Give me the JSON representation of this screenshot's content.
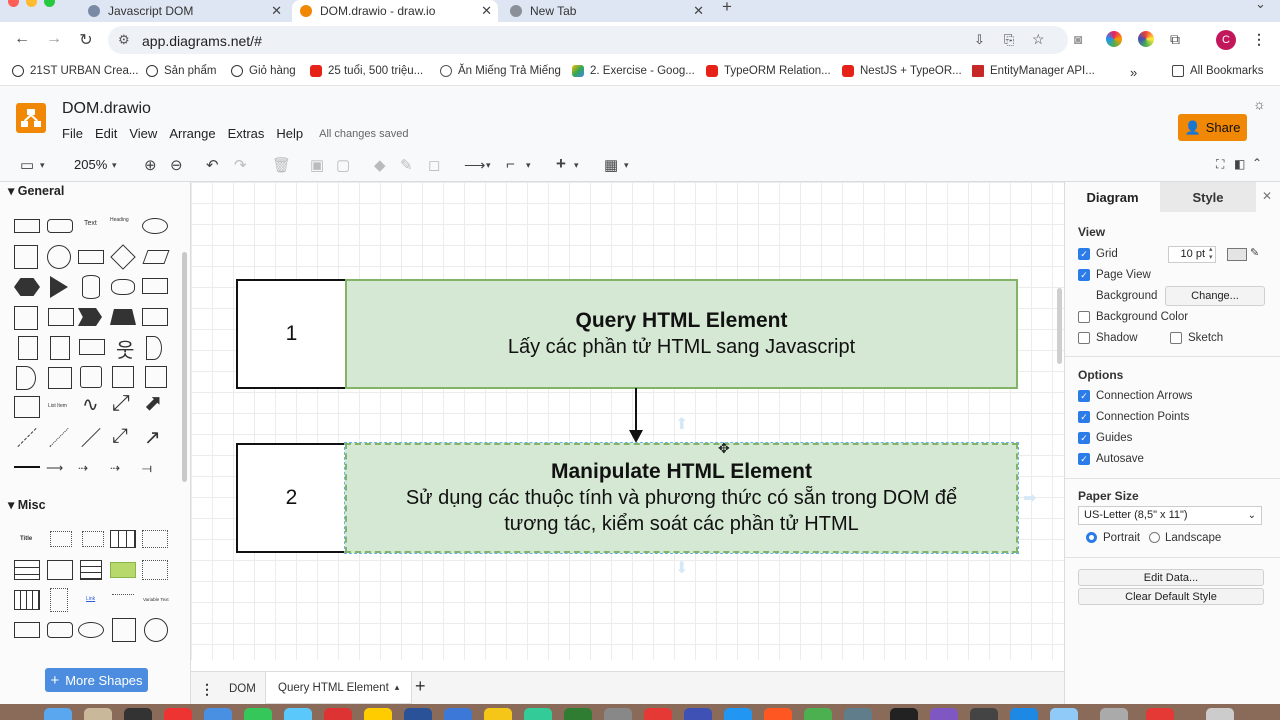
{
  "browser": {
    "tabs": [
      {
        "label": "Javascript DOM",
        "active": false
      },
      {
        "label": "DOM.drawio - draw.io",
        "active": true
      },
      {
        "label": "New Tab",
        "active": false
      }
    ],
    "url": "app.diagrams.net/#",
    "profile_initial": "C",
    "bookmarks": [
      {
        "label": "21ST URBAN Crea..."
      },
      {
        "label": "Sản phẩm"
      },
      {
        "label": "Giỏ hàng"
      },
      {
        "label": "25 tuổi, 500 triệu..."
      },
      {
        "label": "Ăn Miếng Trả Miếng"
      },
      {
        "label": "2. Exercise - Goog..."
      },
      {
        "label": "TypeORM Relation..."
      },
      {
        "label": "NestJS + TypeOR..."
      },
      {
        "label": "EntityManager API..."
      }
    ],
    "all_bookmarks": "All Bookmarks"
  },
  "app": {
    "doc_title": "DOM.drawio",
    "menu": [
      "File",
      "Edit",
      "View",
      "Arrange",
      "Extras",
      "Help"
    ],
    "save_status": "All changes saved",
    "share_label": "Share",
    "zoom": "205%"
  },
  "sidebar": {
    "general": "General",
    "misc": "Misc",
    "more_shapes": "More Shapes",
    "shape_labels": {
      "text": "Text",
      "heading": "Heading",
      "list_item": "List Item",
      "title": "Title",
      "link": "Link",
      "variable_text": "Variable Text"
    }
  },
  "diagram": {
    "box1_number": "1",
    "box1_title": "Query HTML Element",
    "box1_sub": "Lấy các phần tử HTML sang Javascript",
    "box2_number": "2",
    "box2_title": "Manipulate HTML Element",
    "box2_sub1": "Sử dụng các thuộc tính và phương thức có sẵn trong DOM để",
    "box2_sub2": "tương tác, kiểm soát các phần tử HTML"
  },
  "format_panel": {
    "tab_diagram": "Diagram",
    "tab_style": "Style",
    "view_heading": "View",
    "grid": {
      "label": "Grid",
      "checked": true,
      "size": "10 pt"
    },
    "page_view": {
      "label": "Page View",
      "checked": true
    },
    "background_label": "Background",
    "change_button": "Change...",
    "background_color": {
      "label": "Background Color",
      "checked": false
    },
    "shadow": {
      "label": "Shadow",
      "checked": false
    },
    "sketch": {
      "label": "Sketch",
      "checked": false
    },
    "options_heading": "Options",
    "connection_arrows": {
      "label": "Connection Arrows",
      "checked": true
    },
    "connection_points": {
      "label": "Connection Points",
      "checked": true
    },
    "guides": {
      "label": "Guides",
      "checked": true
    },
    "autosave": {
      "label": "Autosave",
      "checked": true
    },
    "paper_size_heading": "Paper Size",
    "paper_size": "US-Letter (8,5\" x 11\")",
    "portrait": "Portrait",
    "landscape": "Landscape",
    "orientation": "Portrait",
    "edit_data": "Edit Data...",
    "clear_default_style": "Clear Default Style"
  },
  "pages": {
    "tabs": [
      "DOM",
      "Query HTML Element"
    ],
    "active": "Query HTML Element"
  },
  "colors": {
    "accent_orange": "#f08705",
    "box_fill": "#d5e8d4",
    "box_stroke": "#82b366",
    "checkbox_blue": "#2b7ce9",
    "more_shapes_blue": "#4c8de0"
  }
}
